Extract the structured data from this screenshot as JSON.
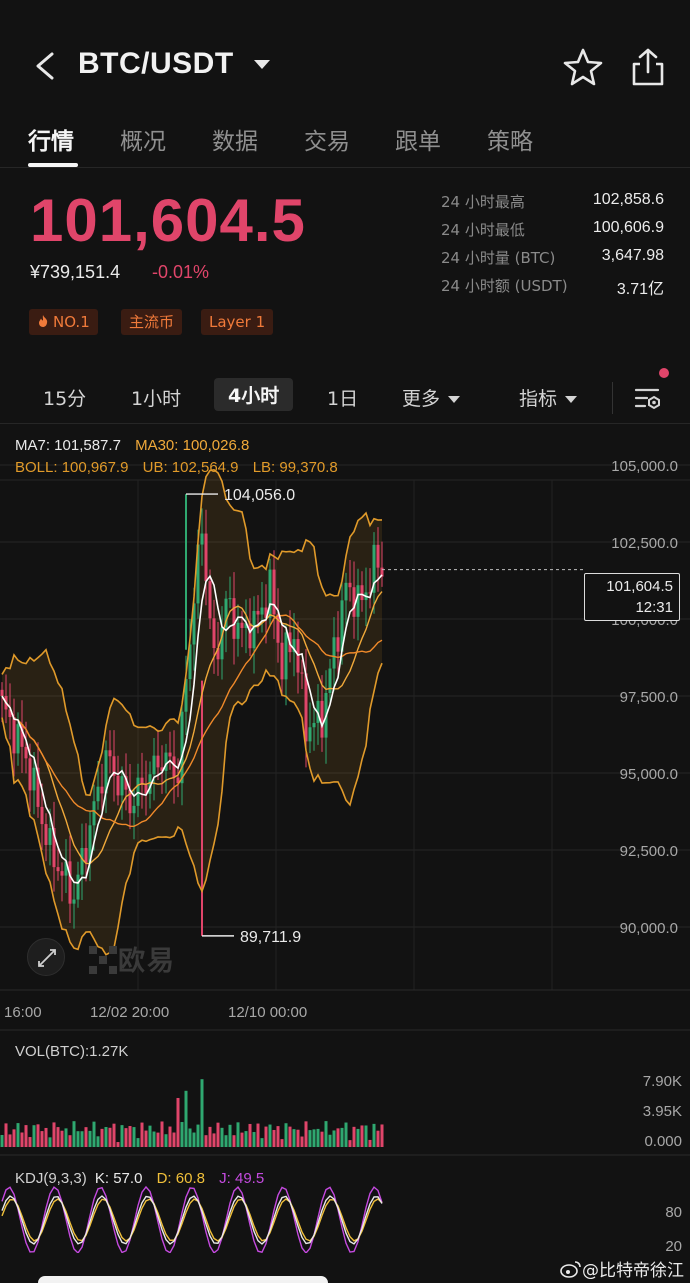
{
  "header": {
    "pair": "BTC/USDT"
  },
  "tabs": [
    "行情",
    "概况",
    "数据",
    "交易",
    "跟单",
    "策略"
  ],
  "ticker": {
    "last_price": "101,604.5",
    "cny_price": "¥739,151.4",
    "change_pct": "-0.01%",
    "badges": [
      "NO.1",
      "主流币",
      "Layer 1"
    ],
    "stats": [
      {
        "label": "24 小时最高",
        "value": "102,858.6"
      },
      {
        "label": "24 小时最低",
        "value": "100,606.9"
      },
      {
        "label": "24 小时量 (BTC)",
        "value": "3,647.98"
      },
      {
        "label": "24 小时额 (USDT)",
        "value": "3.71亿"
      }
    ]
  },
  "periods": {
    "items": [
      "15分",
      "1小时",
      "4小时",
      "1日"
    ],
    "active": "4小时",
    "more": "更多",
    "indicators": "指标"
  },
  "main_chart": {
    "ma7": "MA7: 101,587.7",
    "ma30": "MA30: 100,026.8",
    "boll": "BOLL: 100,967.9",
    "ub": "UB: 102,564.9",
    "lb": "LB: 99,370.8",
    "y_ticks": [
      "105,000.0",
      "102,500.0",
      "100,000.0",
      "97,500.0",
      "95,000.0",
      "92,500.0",
      "90,000.0"
    ],
    "x_ticks": [
      "16:00",
      "12/02 20:00",
      "12/10 00:00"
    ],
    "high_marker": "104,056.0",
    "low_marker": "89,711.9",
    "current_price_label": "101,604.5",
    "countdown": "12:31",
    "watermark": "欧易"
  },
  "volume_chart": {
    "title": "VOL(BTC):1.27K",
    "y_ticks": [
      "7.90K",
      "3.95K",
      "0.000"
    ]
  },
  "kdj_chart": {
    "title": "KDJ(9,3,3)",
    "k": "K: 57.0",
    "d": "D: 60.8",
    "j": "J: 49.5",
    "y_ticks": [
      "80",
      "20"
    ]
  },
  "footer": {
    "weibo_handle": "@比特帝徐江"
  },
  "colors": {
    "up": "#2fa870",
    "down": "#e0456a",
    "ma7": "#ffffff",
    "ma30": "#f0a93a",
    "boll": "#e09a2a",
    "accent_orange": "#f07a3a"
  }
}
